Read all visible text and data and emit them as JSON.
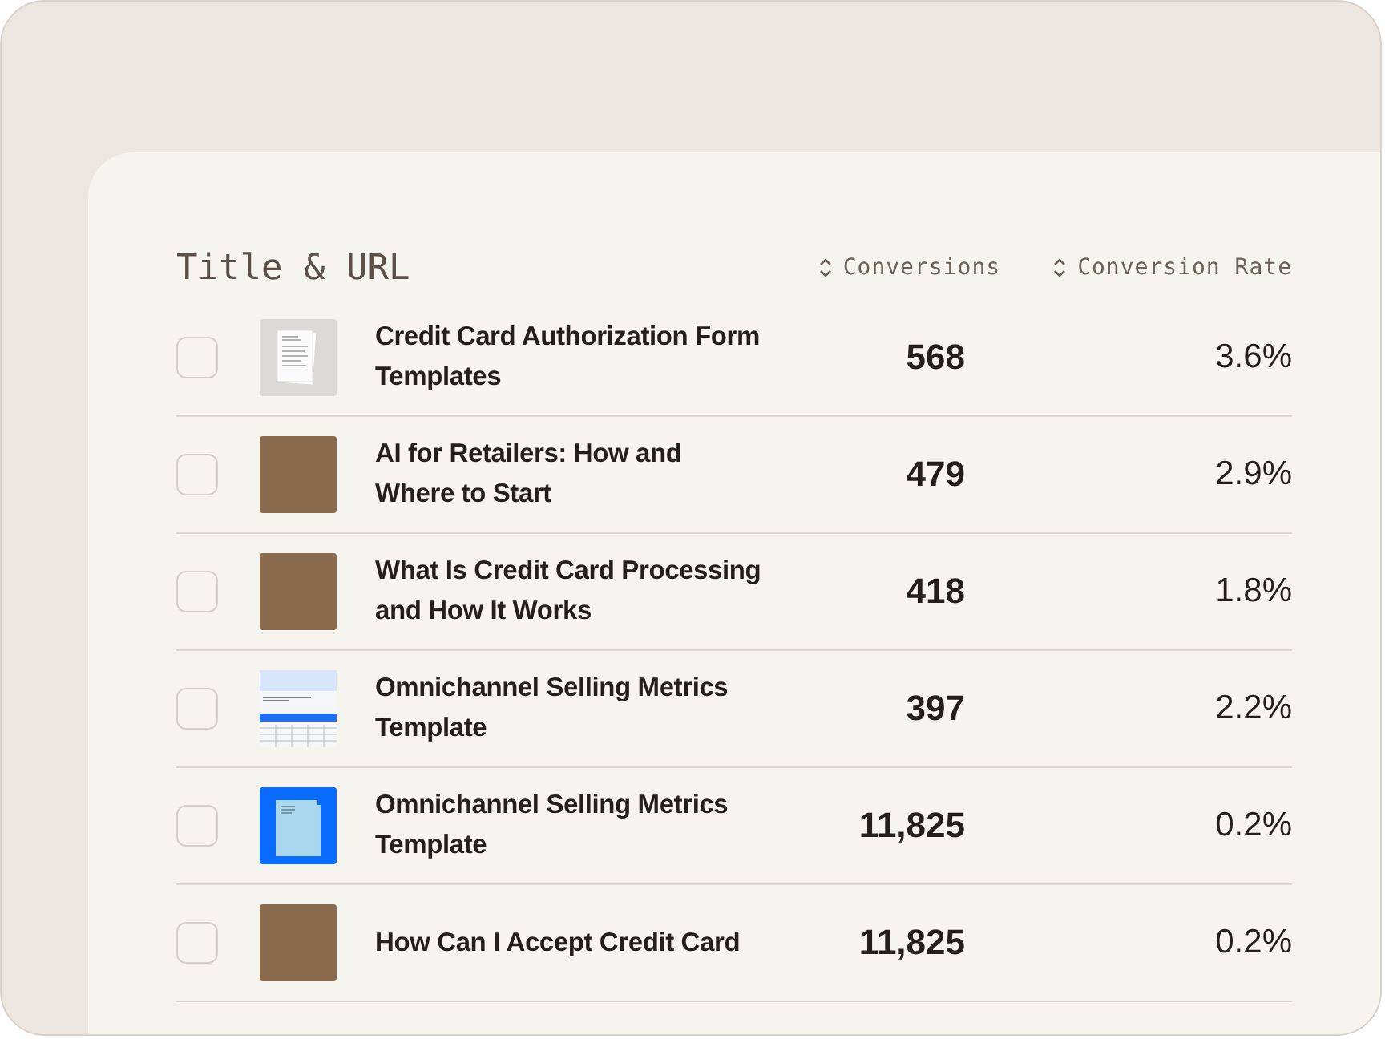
{
  "table": {
    "columns": [
      {
        "label": "Title & URL",
        "sortable": false
      },
      {
        "label": "Conversions",
        "sortable": true
      },
      {
        "label": "Conversion Rate",
        "sortable": true
      }
    ],
    "rows": [
      {
        "checked": false,
        "kind": "document",
        "title": "Credit Card Authorization Form Templates",
        "conversions": "568",
        "rate": "3.6%"
      },
      {
        "checked": false,
        "kind": "photo",
        "title": "AI for Retailers: How and Where to Start",
        "conversions": "479",
        "rate": "2.9%"
      },
      {
        "checked": false,
        "kind": "photo",
        "title": "What Is Credit Card Processing and How It Works",
        "conversions": "418",
        "rate": "1.8%"
      },
      {
        "checked": false,
        "kind": "spreadsheet",
        "title": "Omnichannel Selling Metrics Template",
        "conversions": "397",
        "rate": "2.2%"
      },
      {
        "checked": false,
        "kind": "folder",
        "title": "Omnichannel Selling Metrics Template",
        "conversions": "11,825",
        "rate": "0.2%"
      },
      {
        "checked": false,
        "kind": "photo",
        "title": "How Can I Accept Credit Card",
        "conversions": "11,825",
        "rate": "0.2%"
      }
    ]
  }
}
